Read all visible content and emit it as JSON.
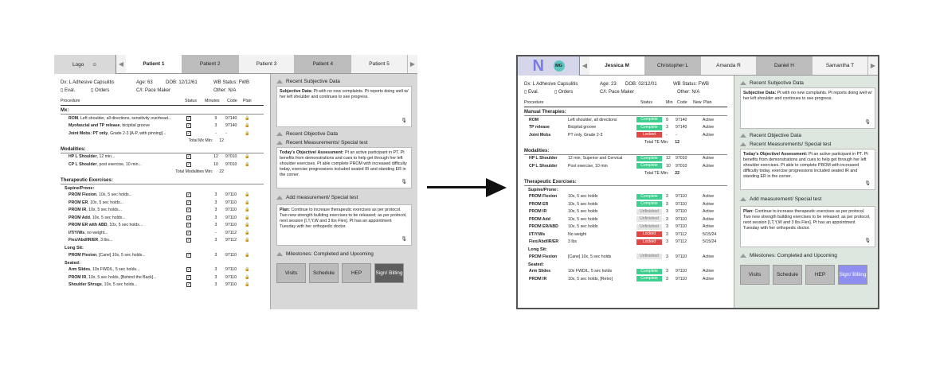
{
  "before": {
    "logo": "Logo",
    "tabs": [
      "Patient 1",
      "Patient 2",
      "Patient 3",
      "Patient 4",
      "Patient 5"
    ],
    "dx": "Dx: L Adhesive Capsulitis",
    "age": "Age: 63",
    "dob": "DOB: 12/12/61",
    "wb": "WB Status: FWB",
    "eval": "Eval.",
    "orders": "Orders",
    "ci": "C/I: Pace Maker",
    "other": "Other: N/A",
    "cols": {
      "proc": "Procedure",
      "status": "Status",
      "min": "Minutes",
      "code": "Code",
      "plan": "Plan"
    },
    "mx": "Mx:",
    "mx_rows": [
      {
        "n": "ROM",
        "d": ", Left shoulder, all directions, sensitivity overhead...",
        "m": "9",
        "c": "97140"
      },
      {
        "n": "Myofascial and TP release",
        "d": ", bicipital groove",
        "m": "3",
        "c": "97140"
      },
      {
        "n": "Joint Mobs: PT only",
        "d": ", Grade 2-3 [A-P, with pinning]...",
        "m": "-",
        "c": "-"
      }
    ],
    "mx_total_label": "Total Mx Min:",
    "mx_total": "12",
    "mod": "Modalities:",
    "mod_rows": [
      {
        "n": "HP L Shoulder",
        "d": ", 12 min...",
        "m": "12",
        "c": "97010"
      },
      {
        "n": "CP L Shoulder",
        "d": ", post exercise, 10 min...",
        "m": "10",
        "c": "97010"
      }
    ],
    "mod_total_label": "Total Modalities Min:",
    "mod_total": "22",
    "ther": "Therapeutic Exercises:",
    "sup": "Supine/Prone:",
    "sup_rows": [
      {
        "n": "PROM Flexion",
        "d": ", 10x, 5 sec holds...",
        "m": "3",
        "c": "97110"
      },
      {
        "n": "PROM ER",
        "d": ", 10x, 5 sec holds...",
        "m": "3",
        "c": "97110"
      },
      {
        "n": "PROM IR",
        "d": ", 10x, 5 sec holds...",
        "m": "3",
        "c": "97110"
      },
      {
        "n": "PROM Add",
        "d": ", 10x, 5 sec holds...",
        "m": "3",
        "c": "97110"
      },
      {
        "n": "PROM ER with ABD",
        "d": ", 10x, 5 sec holds...",
        "m": "3",
        "c": "97110"
      },
      {
        "n": "I/T/Y/Ws",
        "d": ", no weight...",
        "m": "-",
        "c": "97112"
      },
      {
        "n": "Flex/Abd/IR/ER",
        "d": ", 3 lbs...",
        "m": "3",
        "c": "97112"
      }
    ],
    "long": "Long Sit:",
    "long_rows": [
      {
        "n": "PROM Flexion",
        "d": ", [Cane] 10x, 5 sec holds...",
        "m": "3",
        "c": "97110"
      }
    ],
    "seat": "Seated:",
    "seat_rows": [
      {
        "n": "Arm Slides",
        "d": ", 10x FWD/L, 5 sec holds...",
        "m": "3",
        "c": "97110"
      },
      {
        "n": "PROM IR",
        "d": ", 10x, 5 sec holds, [Behind the Back]...",
        "m": "3",
        "c": "97110"
      },
      {
        "n": "Shoulder Shrugs",
        "d": ", 10x, 5 sec holds...",
        "m": "3",
        "c": "97110"
      }
    ],
    "rsd": "Recent Subjective Data",
    "subj_t": "Subjective Data:",
    "subj": "Pt with no new complaints. Pt reports doing well w/ her left shoulder and continues to see progress.",
    "rod": "Recent Objective Data",
    "rms": "Recent Measurements/ Special test",
    "obj_t": "Today's Objective/ Assessment:",
    "obj": "Pt an active participant in PT. Pt benefits from demonstrations and cues to help get through her left shoulder exercises. Pt able complete PROM with increased difficulty today, exercise progressions included seated IR and standing ER in the corner.",
    "addm": "Add measurement/ Special test",
    "plan_t": "Plan:",
    "plan": "Continue to increase therapeutic exercises as per protocol. Two new strength building exercises to be released; as per protocol, next session [I,T,Y,W and 3 lbs Flex]. Pt has an appointment Tuesday with her orthopedic doctor.",
    "mil": "Milestones: Completed and Upcoming",
    "btns": [
      "Visits",
      "Schedule",
      "HEP",
      "Sign/ Billing"
    ]
  },
  "after": {
    "avatar": "MG",
    "tabs": [
      "Jessica M",
      "Christopher L",
      "Amanda R",
      "Daniel H",
      "Samantha T"
    ],
    "dx": "Dx: L Adhesive Capsulitis",
    "age": "Age: 23",
    "dob": "DOB: 02/12/01",
    "wb": "WB Status: FWB",
    "eval": "Eval.",
    "orders": "Orders",
    "ci": "C/I: Pace Maker",
    "other": "Other: N/A",
    "cols": {
      "proc": "Procedure",
      "status": "Status",
      "min": "Min",
      "code": "Code",
      "new": "New",
      "plan": "Plan"
    },
    "mx": "Manual Therapies:",
    "mx_rows": [
      {
        "n": "ROM",
        "d": "Left shoulder, all directions",
        "s": "Complete",
        "m": "9",
        "c": "97140",
        "p": "Active"
      },
      {
        "n": "TP release",
        "d": "Bicipital groove",
        "s": "Complete",
        "m": "3",
        "c": "97140",
        "p": "Active"
      },
      {
        "n": "Joint Mobs",
        "d": "PT only, Grade 2-3",
        "s": "Locked",
        "m": "-",
        "c": "-",
        "p": "Active"
      }
    ],
    "mx_total_label": "Total TE Min:",
    "mx_total": "12",
    "mod": "Modalities:",
    "mod_rows": [
      {
        "n": "HP L Shoulder",
        "d": "12 min, Superior and Cervical",
        "s": "Complete",
        "m": "12",
        "c": "97010",
        "p": "Active"
      },
      {
        "n": "CP L Shoulder",
        "d": "Post exercise, 10 min",
        "s": "Complete",
        "m": "10",
        "c": "97010",
        "p": "Active"
      }
    ],
    "mod_total_label": "Total TE Min:",
    "mod_total": "22",
    "ther": "Therapeutic Exercises:",
    "sup": "Supine/Prone:",
    "sup_rows": [
      {
        "n": "PROM Flexion",
        "d": "10x, 5 sec holds",
        "s": "Complete",
        "m": "3",
        "c": "97110",
        "p": "Active"
      },
      {
        "n": "PROM ER",
        "d": "10x, 5 sec holds",
        "s": "Complete",
        "m": "3",
        "c": "97110",
        "p": "Active"
      },
      {
        "n": "PROM IR",
        "d": "10x, 5 sec holds",
        "s": "Unfinished",
        "m": "3",
        "c": "97110",
        "p": "Active"
      },
      {
        "n": "PROM Add",
        "d": "10x, 5 sec holds",
        "s": "Unfinished",
        "m": "3",
        "c": "97110",
        "p": "Active"
      },
      {
        "n": "PROM ER/ABD",
        "d": "10x, 5 sec holds",
        "s": "Unfinished",
        "m": "3",
        "c": "97110",
        "p": "Active"
      },
      {
        "n": "I/T/Y/Ws",
        "d": "No weight",
        "s": "Locked",
        "m": "3",
        "c": "97112",
        "p": "5/15/24"
      },
      {
        "n": "Flex/Abd/IR/ER",
        "d": "3 lbs",
        "s": "Locked",
        "m": "3",
        "c": "97112",
        "p": "5/15/24"
      }
    ],
    "long": "Long Sit:",
    "long_rows": [
      {
        "n": "PROM Flexion",
        "d": "[Cane] 10x, 5 sec holds",
        "s": "Unfinished",
        "m": "3",
        "c": "97110",
        "p": "Active"
      }
    ],
    "seat": "Seated:",
    "seat_rows": [
      {
        "n": "Arm Slides",
        "d": "10x FWD/L, 5 sec holds",
        "s": "Complete",
        "m": "3",
        "c": "97110",
        "p": "Active"
      },
      {
        "n": "PROM IR",
        "d": "10x, 5 sec holds, [Retro]",
        "s": "Complete",
        "m": "3",
        "c": "97110",
        "p": "Active"
      }
    ],
    "rsd": "Recent Subjective Data",
    "subj_t": "Subjective Data:",
    "subj": "Pt with no new complaints. Pt reports doing well w/ her left shoulder and continues to see progress.",
    "rod": "Recent Objective Data",
    "rms": "Recent Measurements/ Special test",
    "obj_t": "Today's Objective/ Assessment:",
    "obj": "Pt an active participant in PT. Pt benefits from demonstrations and cues to help get through her left shoulder exercises. Pt able to complete PROM with increased difficulty today, exercise progressions included seated IR and standing ER in the corner.",
    "addm": "Add measurement/ Special test",
    "plan_t": "Plan:",
    "plan": "Continue to increase therapeutic exercises as per protocol. Two new strength building exercises to be released; as per protocol, next session [I,T,Y,W and 3 lbs Flex]. Pt has an appointment Tuesday with her orthopedic doctor.",
    "mil": "Milestones: Completed and Upcoming",
    "btns": [
      "Visits",
      "Schedule",
      "HEP",
      "Sign/ Billing"
    ]
  }
}
